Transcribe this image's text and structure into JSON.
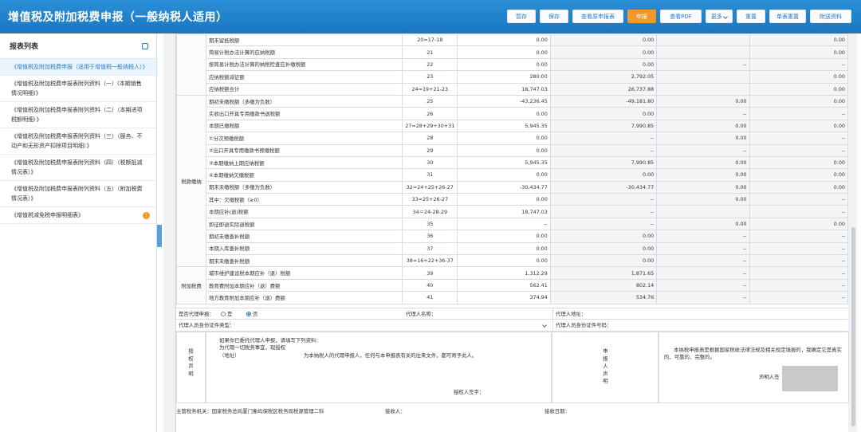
{
  "app": {
    "title": "增值税及附加税费申报（一般纳税人适用）"
  },
  "toolbar": {
    "buttons": [
      "暂存",
      "保存",
      "查看原申报表",
      "申报",
      "查看PDF",
      "更多",
      "重置",
      "单表重置",
      "附送资料"
    ],
    "active": "申报"
  },
  "sidebar": {
    "title": "报表列表",
    "items": [
      "《增值税及附加税费申报（适用于增值税一般纳税人）》",
      "《增值税及附加税费申报表附列资料（一）(本期销售情况明细)》",
      "《增值税及附加税费申报表附列资料（二）（本期进项税额明细）》",
      "《增值税及附加税费申报表附列资料（三）（服务、不动产和无形资产扣除项目明细）》",
      "《增值税及附加税费申报表附列资料（四）（税额抵减情况表）》",
      "《增值税及附加税费申报表附列资料（五）（附加税费情况表）》",
      "《增值税减免税申报明细表》"
    ],
    "badge": "!"
  },
  "table": {
    "rows": [
      {
        "cat": "",
        "name": "期末留抵税额",
        "line": "20=17-18",
        "c1": "0.00",
        "c2": "0.00",
        "c3": "",
        "c4": "0.00"
      },
      {
        "cat": "",
        "name": "简易计税办法计算的应纳税额",
        "line": "21",
        "c1": "0.00",
        "c2": "0.00",
        "c3": "",
        "c4": "0.00"
      },
      {
        "cat": "",
        "name": "按简易计税办法计算的纳税检查应补缴税额",
        "line": "22",
        "c1": "0.00",
        "c2": "0.00",
        "c3": "--",
        "c4": "--"
      },
      {
        "cat": "",
        "name": "应纳税额减征额",
        "line": "23",
        "c1": "280.00",
        "c2": "2,792.05",
        "c3": "",
        "c4": "0.00"
      },
      {
        "cat": "",
        "name": "应纳税额合计",
        "line": "24=19+21-23",
        "c1": "18,747.03",
        "c2": "26,737.88",
        "c3": "",
        "c4": "0.00"
      },
      {
        "cat": "税款缴纳",
        "name": "期初未缴税额（多缴为负数）",
        "line": "25",
        "c1": "-43,236.45",
        "c2": "-49,181.80",
        "c3": "0.00",
        "c4": "0.00"
      },
      {
        "cat": "",
        "name": "实收出口开具专用缴款书退税额",
        "line": "26",
        "c1": "0.00",
        "c2": "0.00",
        "c3": "--",
        "c4": "--"
      },
      {
        "cat": "",
        "name": "本期已缴税额",
        "line": "27=28+29+30+31",
        "c1": "5,945.35",
        "c2": "7,990.85",
        "c3": "0.00",
        "c4": "0.00"
      },
      {
        "cat": "",
        "name": "①分次预缴税额",
        "line": "28",
        "c1": "0.00",
        "c2": "--",
        "c3": "0.00",
        "c4": "--"
      },
      {
        "cat": "",
        "name": "②出口开具专用缴款书预缴税额",
        "line": "29",
        "c1": "0.00",
        "c2": "--",
        "c3": "--",
        "c4": "--"
      },
      {
        "cat": "",
        "name": "③本期缴纳上期应纳税额",
        "line": "30",
        "c1": "5,945.35",
        "c2": "7,990.85",
        "c3": "0.00",
        "c4": "0.00"
      },
      {
        "cat": "",
        "name": "④本期缴纳欠缴税额",
        "line": "31",
        "c1": "0.00",
        "c2": "0.00",
        "c3": "0.00",
        "c4": "0.00"
      },
      {
        "cat": "",
        "name": "期末未缴税额（多缴为负数）",
        "line": "32=24+25+26-27",
        "c1": "-30,434.77",
        "c2": "-30,434.77",
        "c3": "0.00",
        "c4": "0.00"
      },
      {
        "cat": "",
        "name": "其中：欠缴税额（≥0）",
        "line": "33=25+26-27",
        "c1": "0.00",
        "c2": "--",
        "c3": "0.00",
        "c4": "--"
      },
      {
        "cat": "",
        "name": "本期应补(退)税额",
        "line": "34＝24-28-29",
        "c1": "18,747.03",
        "c2": "--",
        "c3": "",
        "c4": "--"
      },
      {
        "cat": "",
        "name": "即征即退实际退税额",
        "line": "35",
        "c1": "--",
        "c2": "--",
        "c3": "0.00",
        "c4": "0.00"
      },
      {
        "cat": "",
        "name": "期初未缴查补税额",
        "line": "36",
        "c1": "0.00",
        "c2": "0.00",
        "c3": "--",
        "c4": "--"
      },
      {
        "cat": "",
        "name": "本期入库查补税额",
        "line": "37",
        "c1": "0.00",
        "c2": "0.00",
        "c3": "--",
        "c4": "--"
      },
      {
        "cat": "",
        "name": "期末未缴查补税额",
        "line": "38=16+22+36-37",
        "c1": "0.00",
        "c2": "0.00",
        "c3": "--",
        "c4": "--"
      },
      {
        "cat": "附加税费",
        "name": "城市维护建设税本期应补（退）税额",
        "line": "39",
        "c1": "1,312.29",
        "c2": "1,871.65",
        "c3": "--",
        "c4": "--"
      },
      {
        "cat": "",
        "name": "教育费附加本期应补（退）费额",
        "line": "40",
        "c1": "562.41",
        "c2": "802.14",
        "c3": "--",
        "c4": "--"
      },
      {
        "cat": "",
        "name": "地方教育附加本期应补（退）费额",
        "line": "41",
        "c1": "374.94",
        "c2": "534.76",
        "c3": "--",
        "c4": "--"
      }
    ]
  },
  "agent": {
    "is_agent_label": "是否代理申报：",
    "yes": "是",
    "no": "否",
    "agent_name_label": "代理人名称：",
    "agent_addr_label": "代理人地址：",
    "id_type_label": "代理人员身份证件类型：",
    "id_no_label": "代理人员身份证件号码："
  },
  "declaration": {
    "auth_label": "授权声明",
    "auth_text1": "如果你已委托代理人申报，请填写下列资料：",
    "auth_text2": "为代理一切税务事宜，现授权",
    "auth_text3": "（地址）",
    "auth_text4": "为本纳税人的代理申报人，任何与本申报表有关的往来文件，都可寄予此人。",
    "auth_sign": "授权人签字：",
    "decl_label": "申报人声明",
    "decl_text": "本纳税申报表是根据国家税收法律法规及相关规定填报的，我确定它是真实的、可靠的、完整的。",
    "decl_sign": "声明人签"
  },
  "footer": {
    "authority": "主管税务机关：国家税务总局厦门象屿保税区税务局税源管理二科",
    "receiver": "接收人：",
    "date": "接收日期："
  }
}
